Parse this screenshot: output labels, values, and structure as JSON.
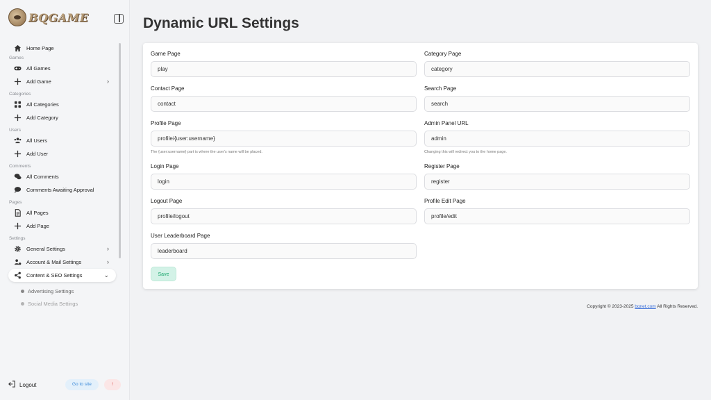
{
  "brand": {
    "name": "BQGAME"
  },
  "sidebar": {
    "sections": {
      "games": "Games",
      "categories": "Categories",
      "users": "Users",
      "comments": "Comments",
      "pages": "Pages",
      "settings": "Settings"
    },
    "items": {
      "home": "Home Page",
      "all_games": "All Games",
      "add_game": "Add Game",
      "all_categories": "All Categories",
      "add_category": "Add Category",
      "all_users": "All Users",
      "add_user": "Add User",
      "all_comments": "All Comments",
      "comments_awaiting": "Comments Awaiting Approval",
      "all_pages": "All Pages",
      "add_page": "Add Page",
      "general_settings": "General Settings",
      "account_mail": "Account & Mail Settings",
      "content_seo": "Content & SEO Settings",
      "advertising": "Advertising Settings",
      "social_media": "Social Media Settings"
    },
    "footer": {
      "logout": "Logout",
      "go_to_site": "Go to site",
      "alert": "!"
    }
  },
  "main": {
    "title": "Dynamic URL Settings",
    "fields": {
      "game_page": {
        "label": "Game Page",
        "value": "play"
      },
      "category_page": {
        "label": "Category Page",
        "value": "category"
      },
      "contact_page": {
        "label": "Contact Page",
        "value": "contact"
      },
      "search_page": {
        "label": "Search Page",
        "value": "search"
      },
      "profile_page": {
        "label": "Profile Page",
        "value": "profile/{user:username}",
        "hint": "The {user:username} part is where the user's name will be placed."
      },
      "admin_panel": {
        "label": "Admin Panel URL",
        "value": "admin",
        "hint": "Changing this will redirect you to the home page."
      },
      "login_page": {
        "label": "Login Page",
        "value": "login"
      },
      "register_page": {
        "label": "Register Page",
        "value": "register"
      },
      "logout_page": {
        "label": "Logout Page",
        "value": "profile/logout"
      },
      "profile_edit_page": {
        "label": "Profile Edit Page",
        "value": "profile/edit"
      },
      "leaderboard_page": {
        "label": "User Leaderboard Page",
        "value": "leaderboard"
      }
    },
    "save_label": "Save"
  },
  "footer": {
    "copyright_prefix": "Copyright © 2023-2025",
    "link": "bqnet.com",
    "suffix": "All Rights Reserved."
  },
  "colors": {
    "accent_green": "#18a56b",
    "link_blue": "#3b6fd9",
    "go_to_site_blue": "#3b8ad9",
    "alert_red": "#d9534f"
  }
}
